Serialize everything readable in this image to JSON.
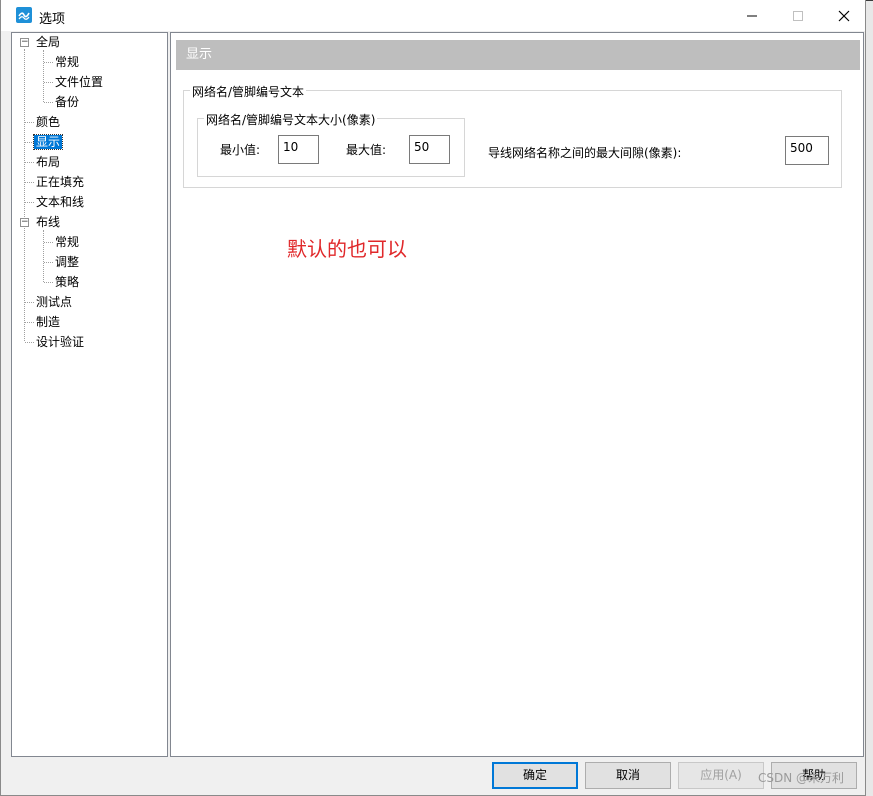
{
  "window": {
    "title": "选项"
  },
  "tree": {
    "items": [
      {
        "label": "全局",
        "level": 0,
        "expander": "minus"
      },
      {
        "label": "常规",
        "level": 1
      },
      {
        "label": "文件位置",
        "level": 1
      },
      {
        "label": "备份",
        "level": 1
      },
      {
        "label": "颜色",
        "level": 0
      },
      {
        "label": "显示",
        "level": 0,
        "selected": true
      },
      {
        "label": "布局",
        "level": 0
      },
      {
        "label": "正在填充",
        "level": 0
      },
      {
        "label": "文本和线",
        "level": 0
      },
      {
        "label": "布线",
        "level": 0,
        "expander": "minus"
      },
      {
        "label": "常规",
        "level": 1
      },
      {
        "label": "调整",
        "level": 1
      },
      {
        "label": "策略",
        "level": 1
      },
      {
        "label": "测试点",
        "level": 0
      },
      {
        "label": "制造",
        "level": 0
      },
      {
        "label": "设计验证",
        "level": 0
      }
    ]
  },
  "content": {
    "header": "显示",
    "group_outer_title": "网络名/管脚编号文本",
    "group_inner_title": "网络名/管脚编号文本大小(像素)",
    "min_label": "最小值:",
    "min_value": "10",
    "max_label": "最大值:",
    "max_value": "50",
    "gap_label": "导线网络名称之间的最大间隙(像素):",
    "gap_value": "500",
    "note": "默认的也可以"
  },
  "buttons": {
    "ok": "确定",
    "cancel": "取消",
    "apply": "应用(A)",
    "help": "帮助"
  },
  "watermark": "CSDN @朱万利"
}
